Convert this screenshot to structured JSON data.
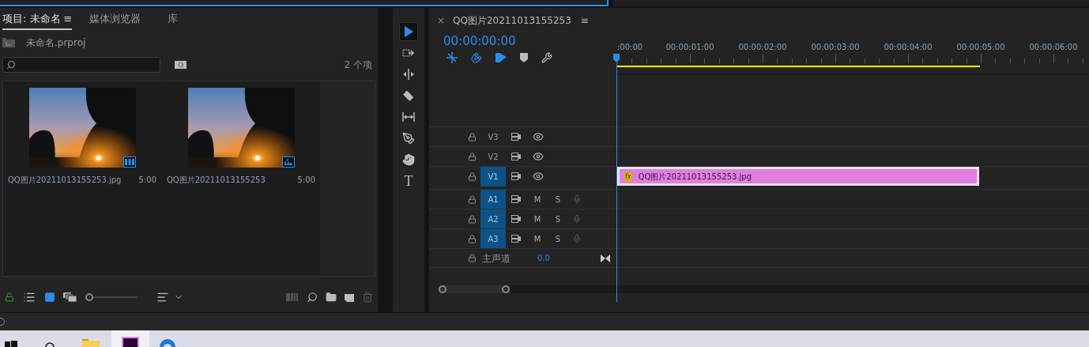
{
  "project_panel": {
    "tabs": [
      {
        "label": "项目: 未命名",
        "selected": true
      },
      {
        "label": "媒体浏览器",
        "selected": false
      },
      {
        "label": "库",
        "selected": false
      }
    ],
    "menu_glyph": "≡",
    "project_file": "未命名.prproj",
    "item_count": "2 个项",
    "items": [
      {
        "name": "QQ图片20211013155253.jpg",
        "duration": "5:00",
        "kind": "clip"
      },
      {
        "name": "QQ图片20211013155253",
        "duration": "5:00",
        "kind": "sequence"
      }
    ],
    "zoom_slider": {
      "level": 0
    }
  },
  "tools": [
    {
      "kind": "select",
      "selected": true
    },
    {
      "kind": "track-select",
      "selected": false
    },
    {
      "kind": "ripple",
      "selected": false
    },
    {
      "kind": "razor",
      "selected": false
    },
    {
      "kind": "slip",
      "selected": false
    },
    {
      "kind": "pen",
      "selected": false
    },
    {
      "kind": "hand",
      "selected": false
    },
    {
      "kind": "type",
      "selected": false,
      "glyph": "T"
    }
  ],
  "timeline": {
    "close_glyph": "×",
    "title": "QQ图片20211013155253",
    "menu_glyph": "≡",
    "timecode": "00:00:00:00",
    "ruler_labels": [
      ":00:00",
      "00:00:01:00",
      "00:00:02:00",
      "00:00:03:00",
      "00:00:04:00",
      "00:00:05:00",
      "00:00:06:00"
    ],
    "tracks": [
      {
        "name": "V3",
        "kind": "video",
        "targeted": false
      },
      {
        "name": "V2",
        "kind": "video",
        "targeted": false
      },
      {
        "name": "V1",
        "kind": "video",
        "targeted": true,
        "clip": {
          "fx": "fx",
          "name": "QQ图片20211013155253.jpg"
        }
      },
      {
        "name": "A1",
        "kind": "audio",
        "targeted": true,
        "mute": "M",
        "solo": "S"
      },
      {
        "name": "A2",
        "kind": "audio",
        "targeted": true,
        "mute": "M",
        "solo": "S"
      },
      {
        "name": "A3",
        "kind": "audio",
        "targeted": true,
        "mute": "M",
        "solo": "S"
      }
    ],
    "master": {
      "label": "主声道",
      "value": "0.0"
    }
  }
}
